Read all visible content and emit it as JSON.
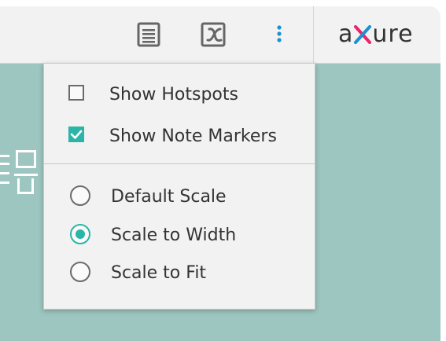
{
  "logo": {
    "text_before": "a",
    "text_after": "ure"
  },
  "toolbar": {
    "notes_icon": "notes-list-icon",
    "variables_icon": "variable-x-icon",
    "more_icon": "more-vertical-icon"
  },
  "menu": {
    "options": [
      {
        "label": "Show Hotspots",
        "checked": false
      },
      {
        "label": "Show Note Markers",
        "checked": true
      }
    ],
    "scales": [
      {
        "label": "Default Scale",
        "selected": false
      },
      {
        "label": "Scale to Width",
        "selected": true
      },
      {
        "label": "Scale to Fit",
        "selected": false
      }
    ]
  },
  "colors": {
    "accent": "#2bb5a8",
    "more_icon": "#1f8fcf",
    "background_canvas": "#9ec6c0",
    "toolbar": "#f2f2f2"
  }
}
